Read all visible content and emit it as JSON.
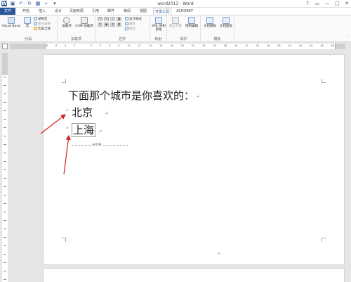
{
  "window": {
    "title": "word2013 - Word",
    "controls": {
      "help": "?",
      "restore": "▭",
      "minimize": "—",
      "maximize": "□",
      "close": "✕"
    }
  },
  "tabs": [
    {
      "label": "文件",
      "state": "file"
    },
    {
      "label": "开始",
      "state": ""
    },
    {
      "label": "插入",
      "state": ""
    },
    {
      "label": "设计",
      "state": ""
    },
    {
      "label": "页面布局",
      "state": ""
    },
    {
      "label": "引用",
      "state": ""
    },
    {
      "label": "邮件",
      "state": ""
    },
    {
      "label": "审阅",
      "state": ""
    },
    {
      "label": "视图",
      "state": ""
    },
    {
      "label": "开发工具",
      "state": "active"
    },
    {
      "label": "ACROBAT",
      "state": ""
    }
  ],
  "ribbon": {
    "code": {
      "label": "代码",
      "visual_basic": "Visual Basic",
      "macros": "宏",
      "record_macro": "录制宏",
      "pause_recording": "暂停录制",
      "macro_security": "宏安全性"
    },
    "addins": {
      "label": "加载项",
      "addins_btn": "加载项",
      "com_addins": "COM 加载项"
    },
    "controls": {
      "label": "控件",
      "grid_row1": [
        "Aa",
        "Aa",
        "☑",
        "▦"
      ],
      "grid_row2": [
        "▤",
        "▣",
        "▥",
        "▦"
      ],
      "design_mode": "设计模式",
      "properties": "属性",
      "group": "组合"
    },
    "mapping": {
      "label": "映射",
      "xml_mapping": "XML 映射窗格"
    },
    "protect": {
      "label": "保护",
      "block_authors": "阻止作者",
      "restrict_editing": "限制编辑"
    },
    "templates": {
      "label": "模板",
      "document_template": "文档模板",
      "document_panel": "文档面板"
    }
  },
  "ruler": {
    "h_numbers": [
      "8",
      "6",
      "4",
      "2",
      "",
      "2",
      "4",
      "6",
      "8",
      "10",
      "12",
      "14",
      "16",
      "18",
      "20",
      "22",
      "24",
      "26",
      "28",
      "30",
      "32",
      "34",
      "36",
      "38",
      "40",
      "42",
      "44",
      "46",
      "48"
    ]
  },
  "document": {
    "heading": "下面那个城市是你喜欢的：",
    "option1": "北京",
    "option2": "上海",
    "page_break": "分页符",
    "para_mark": "↵",
    "ctrl_mark": "#"
  }
}
